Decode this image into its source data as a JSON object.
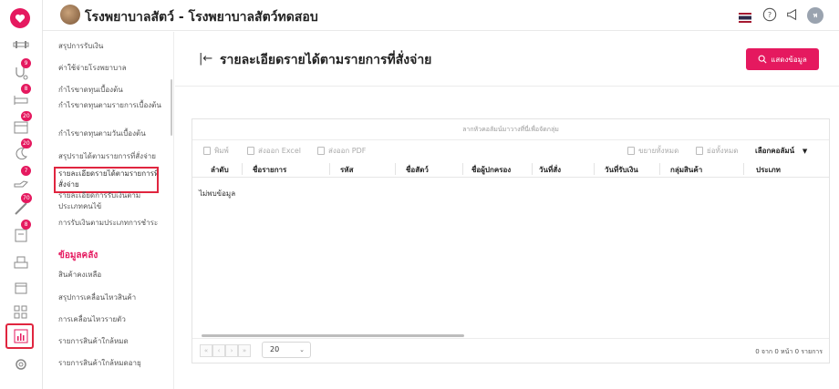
{
  "header": {
    "title": "โรงพยาบาลสัตว์ - โรงพยาบาลสัตว์ทดสอบ",
    "user_initial": "พ",
    "icons": [
      "thai-flag-icon",
      "help-icon",
      "megaphone-icon",
      "user-avatar"
    ]
  },
  "rail": {
    "badges": {
      "b1": "9",
      "b2": "8",
      "b3": "20",
      "b4": "20",
      "b5": "7",
      "b6": "70",
      "b7": "8"
    }
  },
  "subnav": {
    "items": [
      "สรุปการรับเงิน",
      "ค่าใช้จ่ายโรงพยาบาล",
      "กำไรขาดทุนเบื้องต้น",
      "กำไรขาดทุนตามรายการเบื้องต้น",
      "กำไรขาดทุนตามวันเบื้องต้น",
      "สรุปรายได้ตามรายการที่สั่งจ่าย",
      "รายละเอียดรายได้ตามรายการที่สั่งจ่าย",
      "รายละเอียดการรับเงินตามประเภทคนไข้",
      "การรับเงินตามประเภทการชำระ"
    ],
    "section_head": "ข้อมูลคลัง",
    "stock_items": [
      "สินค้าคงเหลือ",
      "สรุปการเคลื่อนไหวสินค้า",
      "การเคลื่อนไหวรายตัว",
      "รายการสินค้าใกล้หมด",
      "รายการสินค้าใกล้หมดอายุ"
    ]
  },
  "page": {
    "title": "รายละเอียดรายได้ตามรายการที่สั่งจ่าย",
    "show_button": "แสดงข้อมูล"
  },
  "grid": {
    "group_hint": "ลากหัวคอลัมน์มาวางที่นี่เพื่อจัดกลุ่ม",
    "toolbar": {
      "print": "พิมพ์",
      "export_excel": "ส่งออก Excel",
      "export_pdf": "ส่งออก PDF",
      "expand_all": "ขยายทั้งหมด",
      "collapse_all": "ย่อทั้งหมด",
      "choose_columns": "เลือกคอลัมน์"
    },
    "columns": [
      "ลำดับ",
      "ชื่อรายการ",
      "รหัส",
      "ชื่อสัตว์",
      "ชื่อผู้ปกครอง",
      "วันที่สั่ง",
      "วันที่รับเงิน",
      "กลุ่มสินค้า",
      "ประเภท"
    ],
    "empty_text": "ไม่พบข้อมูล",
    "page_size": "20",
    "pager_buttons": [
      "«",
      "‹",
      "›",
      "»"
    ],
    "page_info": "0 จาก 0 หน้า 0 รายการ"
  },
  "colors": {
    "accent": "#e5195f",
    "highlight_border": "#e0253f"
  }
}
